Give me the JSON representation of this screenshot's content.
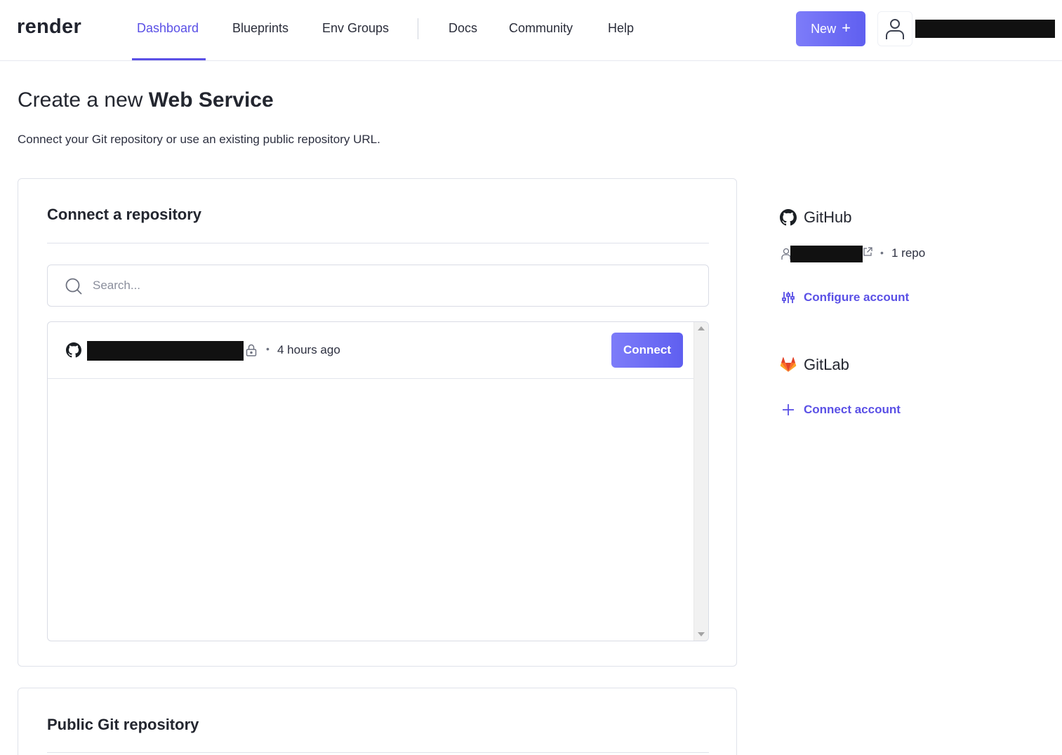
{
  "brand": {
    "logo_text": "render"
  },
  "nav": {
    "items": [
      {
        "label": "Dashboard",
        "active": true
      },
      {
        "label": "Blueprints"
      },
      {
        "label": "Env Groups"
      },
      {
        "label": "Docs"
      },
      {
        "label": "Community"
      },
      {
        "label": "Help"
      }
    ],
    "new_button": {
      "label": "New",
      "icon": "plus-icon"
    }
  },
  "header": {
    "title_prefix": "Create a new ",
    "title_bold": "Web Service",
    "subtitle": "Connect your Git repository or use an existing public repository URL."
  },
  "connect_card": {
    "title": "Connect a repository",
    "search": {
      "placeholder": "Search...",
      "value": ""
    },
    "repos": [
      {
        "updated": "4 hours ago",
        "private": true,
        "connect_label": "Connect",
        "provider_icon": "github-icon"
      }
    ]
  },
  "public_card": {
    "title": "Public Git repository"
  },
  "sidebar": {
    "github": {
      "title": "GitHub",
      "repo_count": "1 repo",
      "configure_label": "Configure account"
    },
    "gitlab": {
      "title": "GitLab",
      "connect_label": "Connect account"
    }
  },
  "colors": {
    "accent": "#5a50e6",
    "button_gradient_start": "#7d7cf9",
    "button_gradient_end": "#5f5ff0",
    "redacted": "#111111"
  }
}
